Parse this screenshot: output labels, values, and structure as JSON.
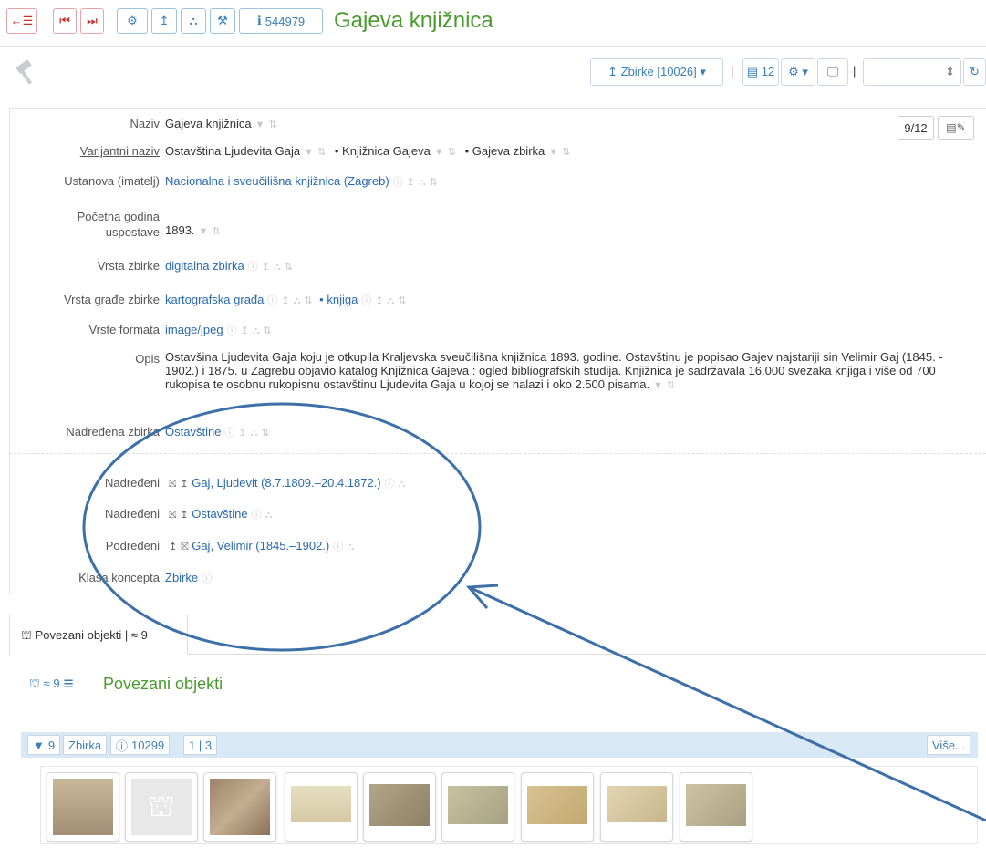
{
  "toolbar": {
    "back_list": "←☰",
    "first": "⏮",
    "last": "⏭",
    "settings": "⚙",
    "up": "↥",
    "tree": "⛬",
    "hammer": "⚒",
    "info_prefix": "ℹ",
    "record_id": "544979"
  },
  "title": "Gajeva knjižnica",
  "subbar": {
    "zbirke": "↥ Zbirke [10026] ▾",
    "sep": "|",
    "counter_btn": "▤ 12",
    "gear_btn": "⚙ ▾",
    "monitor_btn": "🖵",
    "select_arrow": "⇕",
    "refresh": "↻"
  },
  "record": {
    "counter": "9/12",
    "fields": [
      {
        "label": "Naziv",
        "value": "Gajeva knjižnica"
      },
      {
        "label": "Varijantni naziv",
        "v1": "Ostavština Ljudevita Gaja",
        "v2": "• Knjižnica Gajeva",
        "v3": "• Gajeva zbirka"
      },
      {
        "label": "Ustanova (imatelj)",
        "value": "Nacionalna i sveučilišna knjižnica (Zagreb)"
      },
      {
        "label": "Početna godina uspostave",
        "value": "1893."
      },
      {
        "label": "Vrsta zbirke",
        "value": "digitalna zbirka"
      },
      {
        "label": "Vrsta građe zbirke",
        "v1": "kartografska građa",
        "v2": "• knjiga"
      },
      {
        "label": "Vrste formata",
        "value": "image/jpeg"
      },
      {
        "label": "Opis",
        "value": "Ostavšina Ljudevita Gaja koju je otkupila Kraljevska sveučilišna knjižnica 1893. godine. Ostavštinu je popisao Gajev najstariji sin Velimir Gaj (1845. - 1902.) i 1875. u Zagrebu objavio katalog Knjižnica Gajeva : ogled bibliografskih studija. Knjižnica je sadržavala 16.000 svezaka knjiga i više od 700 rukopisa te osobnu rukopisnu ostavštinu Ljudevita Gaja u kojoj se nalazi i oko 2.500 pisama."
      },
      {
        "label": "Nadređena zbirka",
        "value": "Ostavštine"
      }
    ],
    "relations": [
      {
        "label": "Nadređeni",
        "value": "Gaj, Ljudevit (8.7.1809.–20.4.1872.)"
      },
      {
        "label": "Nadređeni",
        "value": "Ostavštine"
      },
      {
        "label": "Podređeni",
        "value": "Gaj, Velimir (1845.–1902.)"
      },
      {
        "label": "Klasa koncepta",
        "value": "Zbirke"
      }
    ]
  },
  "tab": {
    "label": "Povezani objekti | ≈ 9"
  },
  "related": {
    "count_label": "≈ 9",
    "title": "Povezani objekti",
    "filters": [
      "9",
      "Zbirka",
      "10299",
      "1 | 3"
    ],
    "more": "Više..."
  },
  "colors": {
    "accent_green": "#4a9b2f",
    "link_blue": "#2a6ab0",
    "annotation_blue": "#3d6fa8",
    "red": "#c9302c"
  }
}
